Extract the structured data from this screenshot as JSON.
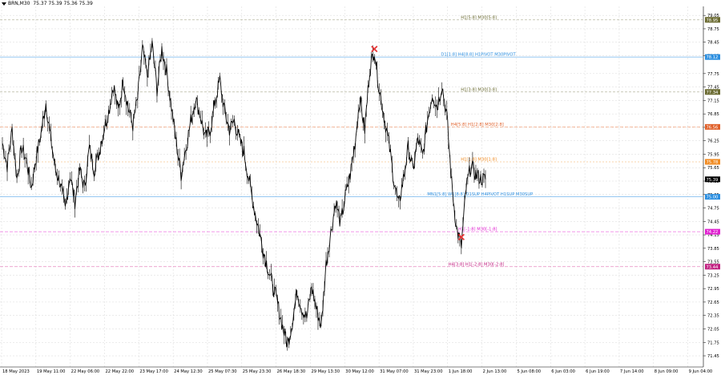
{
  "header": {
    "symbol": "BRN,M30",
    "ohlc": "75.37 75.39 75.36 75.39"
  },
  "colors": {
    "background": "#ffffff",
    "grid": "#d8d8d8",
    "candle": "#000000",
    "blue_line": "#87c0f0",
    "orange_line": "#f4a883",
    "olive_dash": "#b8b8a0",
    "orange_dash": "#f7c890",
    "magenta_dash": "#f08ae6",
    "pink_dash": "#e589c0",
    "price_box": "#000000",
    "marker": "#e53535"
  },
  "chart_data": {
    "type": "line",
    "title": "",
    "ylim": [
      71.2,
      79.25
    ],
    "y_ticks": [
      "79.05",
      "78.75",
      "78.45",
      "78.15",
      "77.75",
      "77.45",
      "77.15",
      "76.85",
      "76.55",
      "76.25",
      "75.95",
      "75.65",
      "75.35",
      "75.05",
      "74.75",
      "74.45",
      "74.15",
      "73.85",
      "73.55",
      "73.25",
      "72.95",
      "72.65",
      "72.35",
      "72.05",
      "71.75",
      "71.45"
    ],
    "x_ticks": [
      "18 May 2023",
      "19 May 11:00",
      "22 May 06:00",
      "22 May 22:00",
      "23 May 17:00",
      "24 May 12:30",
      "25 May 07:30",
      "25 May 23:30",
      "26 May 18:30",
      "29 May 13:30",
      "30 May 12:00",
      "31 May 07:00",
      "31 May 23:00",
      "1 Jun 18:00",
      "2 Jun 13:00",
      "5 Jun 08:00",
      "6 Jun 03:00",
      "6 Jun 19:00",
      "7 Jun 14:00",
      "8 Jun 09:00",
      "9 Jun 04:00"
    ],
    "series": [
      {
        "values": [
          76.2,
          75.7,
          76.5,
          75.4,
          76.1,
          75.8,
          75.2,
          75.9,
          76.4,
          77.1,
          76.3,
          75.6,
          75.3,
          74.7,
          75.5,
          74.9,
          75.6,
          75.2,
          76.1,
          75.6,
          76.0,
          76.5,
          76.9,
          77.5,
          76.9,
          77.6,
          77.0,
          76.6,
          77.2,
          78.3,
          77.7,
          78.4,
          77.4,
          78.3,
          77.8,
          77.0,
          76.2,
          75.5,
          76.1,
          76.7,
          77.2,
          76.8,
          76.3,
          76.5,
          77.1,
          77.6,
          76.9,
          76.5,
          76.7,
          76.3,
          76.0,
          75.4,
          74.8,
          74.3,
          73.8,
          73.4,
          73.0,
          72.6,
          72.1,
          71.7,
          72.2,
          72.9,
          72.5,
          72.3,
          73.0,
          72.5,
          72.1,
          73.5,
          74.2,
          74.9,
          74.4,
          75.0,
          75.5,
          76.2,
          77.2,
          76.5,
          77.8,
          78.3,
          77.4,
          76.8,
          76.2,
          75.4,
          74.8,
          75.4,
          76.1,
          75.6,
          76.3,
          75.9,
          76.7,
          77.3,
          77.0,
          77.5,
          76.8,
          75.3,
          74.3,
          73.9,
          75.2,
          75.7,
          75.5,
          75.4,
          75.39
        ]
      }
    ],
    "levels": [
      {
        "label": "H1[5:8] M30[5:8]",
        "price": 78.95,
        "tag": "78.95",
        "style": "olive-dash"
      },
      {
        "label": "D1[1:8] H4[8:8] H1PIVOT M30PIVOT",
        "price": 78.12,
        "tag": "78.12",
        "style": "blue-solid"
      },
      {
        "label": "H1[3:8] M30[3:8]",
        "price": 77.34,
        "tag": "77.34",
        "style": "olive-dash"
      },
      {
        "label": "H4[5:8] H1[2:8] M30[2:8]",
        "price": 76.56,
        "tag": "76.56",
        "style": "orange-dash"
      },
      {
        "label": "H1[1:8] M30[1:8]",
        "price": 75.78,
        "tag": "75.78",
        "style": "orange-dot"
      },
      {
        "label": "MN1[5:8] W1[8:8] D1SUP H4PIVOT H1SUP M30SUP",
        "price": 75.0,
        "tag": "75.00",
        "style": "blue-solid"
      },
      {
        "label": "H1[-1:8] M30[-1:8]",
        "price": 74.22,
        "tag": "74.22",
        "style": "magenta-dash"
      },
      {
        "label": "H4[3:8] H1[-2:8] M30[-2:8]",
        "price": 73.44,
        "tag": "73.44",
        "style": "pink-dash"
      }
    ],
    "current_price": "75.39",
    "markers": [
      {
        "type": "x",
        "x_index": 77,
        "price": 78.3
      },
      {
        "type": "x",
        "x_index": 95,
        "price": 74.1
      }
    ]
  }
}
